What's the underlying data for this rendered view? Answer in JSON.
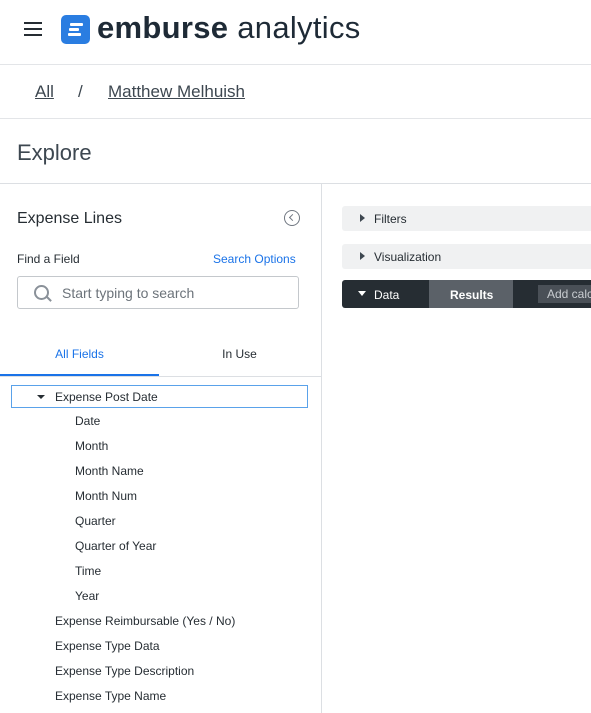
{
  "header": {
    "logo_text_bold": "emburse",
    "logo_text_light": " analytics"
  },
  "breadcrumb": {
    "items": [
      "All",
      "Matthew Melhuish"
    ],
    "separator": "/"
  },
  "page": {
    "title": "Explore"
  },
  "field_picker": {
    "title": "Expense Lines",
    "find_label": "Find a Field",
    "search_options_label": "Search Options",
    "search_placeholder": "Start typing to search",
    "search_value": "",
    "tabs": [
      "All Fields",
      "In Use"
    ],
    "active_tab": "All Fields",
    "expanded_group": "Expense Post Date",
    "group_children": [
      "Date",
      "Month",
      "Month Name",
      "Month Num",
      "Quarter",
      "Quarter of Year",
      "Time",
      "Year"
    ],
    "other_fields": [
      "Expense Reimbursable (Yes / No)",
      "Expense Type Data",
      "Expense Type Description",
      "Expense Type Name"
    ]
  },
  "results_area": {
    "sections": [
      "Filters",
      "Visualization"
    ],
    "data_tab": "Data",
    "results_tab": "Results",
    "add_calc_label": "Add calc"
  },
  "colors": {
    "brand_blue": "#2a7de1",
    "link_blue": "#1a73e8",
    "dark_bar": "#262d33",
    "results_tab_bg": "#5b6168"
  }
}
